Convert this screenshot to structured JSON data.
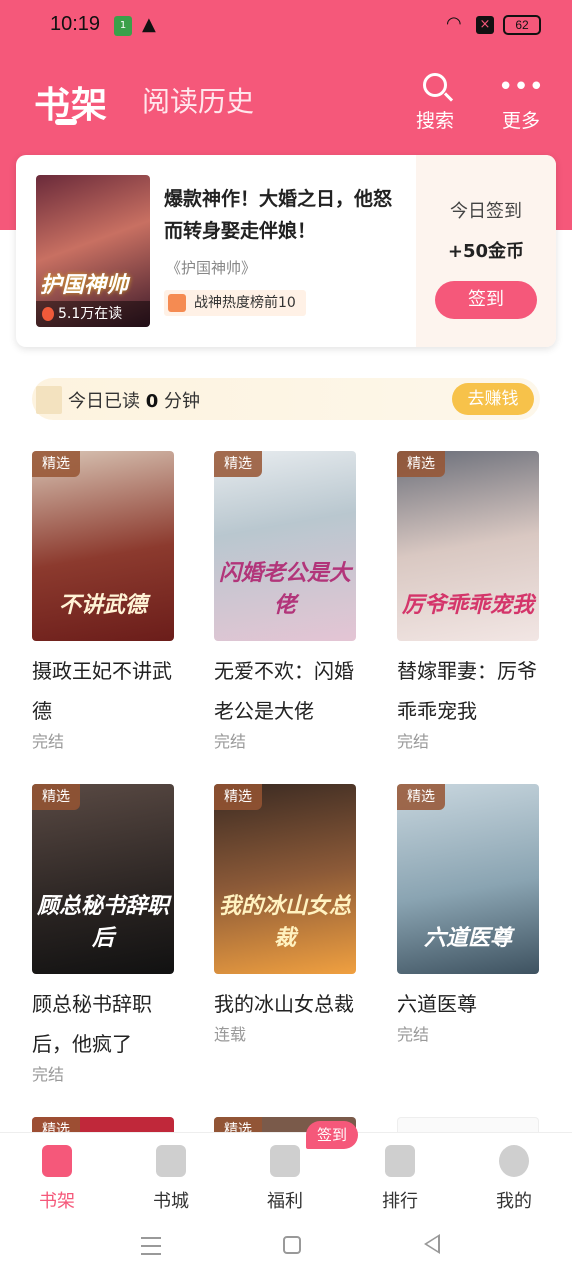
{
  "status_bar": {
    "time": "10:19",
    "battery": "62",
    "sim_label": "1"
  },
  "header": {
    "tab_active": "书架",
    "tab_inactive": "阅读历史",
    "search_label": "搜索",
    "more_label": "更多",
    "more_icon": "•••",
    "colors": {
      "brand": "#f5587a"
    }
  },
  "featured": {
    "cover_title": "护国神帅",
    "readers": "5.1万在读",
    "headline": "爆款神作！大婚之日，他怒而转身娶走伴娘！",
    "book_name": "《护国神帅》",
    "rank_tag": "战神热度榜前10",
    "checkin_title": "今日签到",
    "checkin_reward": "+50金币",
    "checkin_button": "签到"
  },
  "reading_bar": {
    "prefix": "今日已读",
    "minutes": "0",
    "suffix": "分钟",
    "earn_button": "去赚钱"
  },
  "books": [
    {
      "badge": "精选",
      "cover_text": "不讲武德",
      "title": "摄政王妃不讲武德",
      "status": "完结"
    },
    {
      "badge": "精选",
      "cover_text": "闪婚老公是大佬",
      "title": "无爱不欢：闪婚老公是大佬",
      "status": "完结"
    },
    {
      "badge": "精选",
      "cover_text": "厉爷乖乖宠我",
      "title": "替嫁罪妻：厉爷乖乖宠我",
      "status": "完结"
    },
    {
      "badge": "精选",
      "cover_text": "顾总秘书辞职后",
      "title": "顾总秘书辞职后，他疯了",
      "status": "完结"
    },
    {
      "badge": "精选",
      "cover_text": "我的冰山女总裁",
      "title": "我的冰山女总裁",
      "status": "连载"
    },
    {
      "badge": "精选",
      "cover_text": "六道医尊",
      "title": "六道医尊",
      "status": "完结"
    },
    {
      "badge": "精选"
    },
    {
      "badge": "精选"
    }
  ],
  "bottom_nav": {
    "items": [
      {
        "label": "书架"
      },
      {
        "label": "书城"
      },
      {
        "label": "福利"
      },
      {
        "label": "排行"
      },
      {
        "label": "我的"
      }
    ],
    "welfare_badge": "签到"
  }
}
